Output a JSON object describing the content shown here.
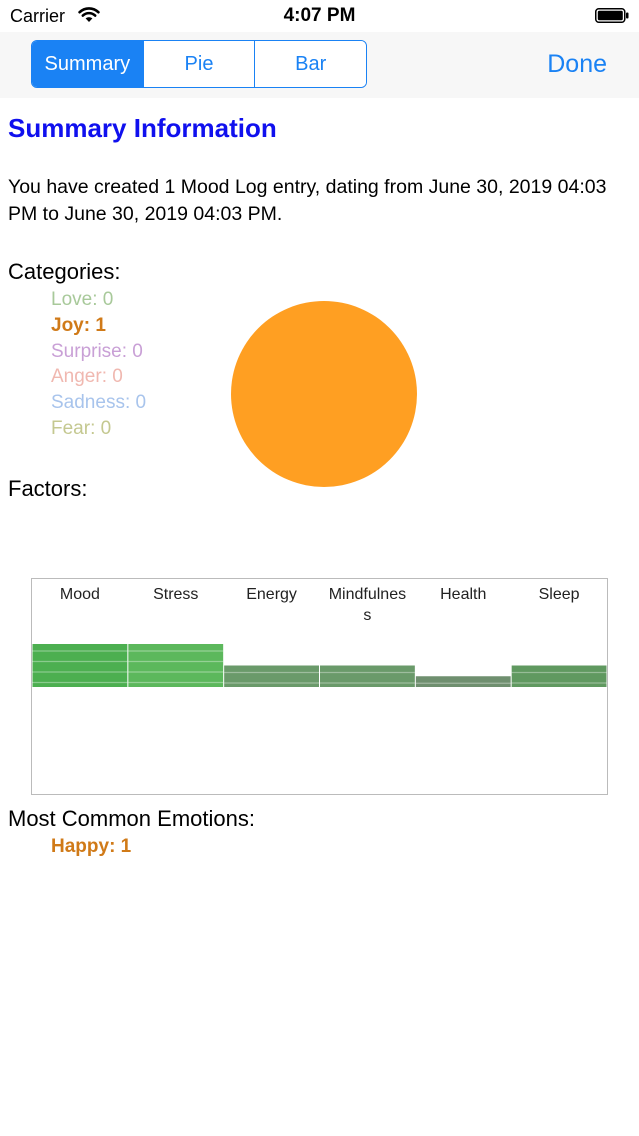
{
  "status_bar": {
    "carrier": "Carrier",
    "time": "4:07 PM"
  },
  "nav": {
    "segments": [
      "Summary",
      "Pie",
      "Bar"
    ],
    "selected_segment": "Summary",
    "done_label": "Done"
  },
  "summary": {
    "title": "Summary Information",
    "intro": "You have created 1 Mood Log entry, dating from June 30, 2019 04:03 PM to June 30, 2019 04:03 PM."
  },
  "categories": {
    "heading": "Categories:",
    "items": [
      {
        "label": "Love: 0",
        "color": "#a8c99a",
        "count": 0
      },
      {
        "label": "Joy: 1",
        "color": "#d07a18",
        "count": 1
      },
      {
        "label": "Surprise: 0",
        "color": "#c9a0d6",
        "count": 0
      },
      {
        "label": "Anger: 0",
        "color": "#f0b8b0",
        "count": 0
      },
      {
        "label": "Sadness: 0",
        "color": "#a8c4ec",
        "count": 0
      },
      {
        "label": "Fear: 0",
        "color": "#c4c890",
        "count": 0
      }
    ],
    "pie_color": "#ff9f22"
  },
  "factors": {
    "heading": "Factors:"
  },
  "chart_data": {
    "type": "bar",
    "categories": [
      "Mood",
      "Stress",
      "Energy",
      "Mindfulness",
      "Health",
      "Sleep"
    ],
    "values": [
      2,
      2,
      1,
      1,
      0.5,
      1
    ],
    "colors": [
      "#4caf50",
      "#5cb85c",
      "#6a9a6a",
      "#6a9a6a",
      "#6f8f6f",
      "#609960"
    ]
  },
  "emotions": {
    "heading": "Most Common Emotions:",
    "items": [
      {
        "label": "Happy: 1",
        "color": "#d07a18"
      }
    ]
  }
}
